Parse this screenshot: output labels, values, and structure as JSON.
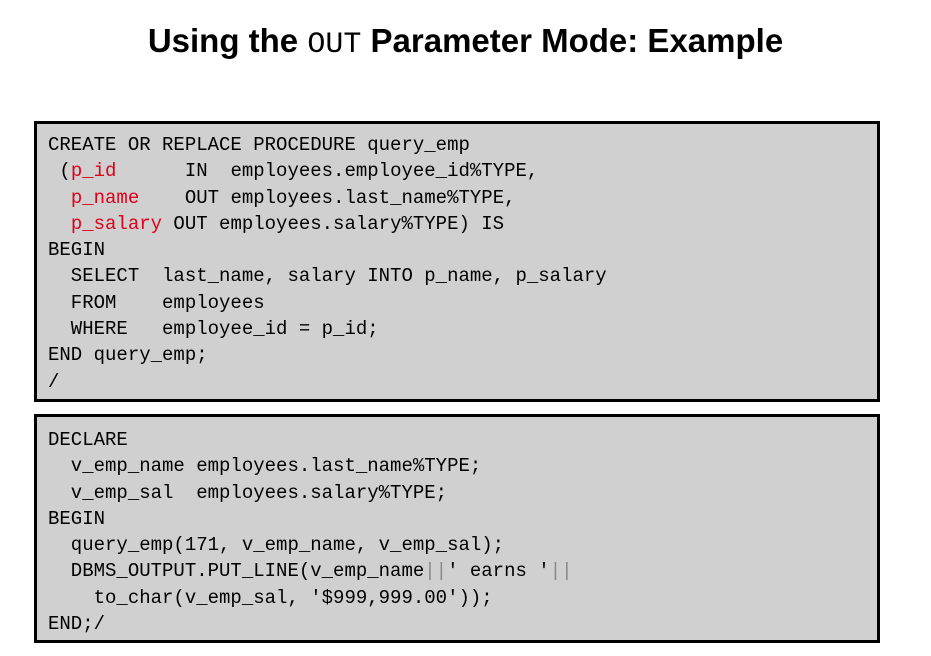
{
  "title": {
    "before": "Using the ",
    "code": "OUT",
    "after": " Parameter Mode: Example"
  },
  "procedure_code": {
    "lines": [
      [
        {
          "text": "CREATE OR REPLACE PROCEDURE query_emp",
          "style": "normal"
        }
      ],
      [
        {
          "text": " (",
          "style": "normal"
        },
        {
          "text": "p_id",
          "style": "red"
        },
        {
          "text": "      IN  employees.employee_id%TYPE,",
          "style": "normal"
        }
      ],
      [
        {
          "text": "  ",
          "style": "normal"
        },
        {
          "text": "p_name",
          "style": "red"
        },
        {
          "text": "    OUT employees.last_name%TYPE,",
          "style": "normal"
        }
      ],
      [
        {
          "text": "  ",
          "style": "normal"
        },
        {
          "text": "p_salary",
          "style": "red"
        },
        {
          "text": " OUT employees.salary%TYPE) IS",
          "style": "normal"
        }
      ],
      [
        {
          "text": "BEGIN",
          "style": "normal"
        }
      ],
      [
        {
          "text": "  SELECT  last_name, salary INTO p_name, p_salary",
          "style": "normal"
        }
      ],
      [
        {
          "text": "  FROM    employees",
          "style": "normal"
        }
      ],
      [
        {
          "text": "  WHERE   employee_id = p_id;",
          "style": "normal"
        }
      ],
      [
        {
          "text": "END query_emp;",
          "style": "normal"
        }
      ],
      [
        {
          "text": "/",
          "style": "normal"
        }
      ]
    ]
  },
  "call_code": {
    "lines": [
      [
        {
          "text": "DECLARE",
          "style": "normal"
        }
      ],
      [
        {
          "text": "  v_emp_name employees.last_name%TYPE;",
          "style": "normal"
        }
      ],
      [
        {
          "text": "  v_emp_sal  employees.salary%TYPE;",
          "style": "normal"
        }
      ],
      [
        {
          "text": "BEGIN",
          "style": "normal"
        }
      ],
      [
        {
          "text": "  query_emp(171, v_emp_name, v_emp_sal);",
          "style": "normal"
        }
      ],
      [
        {
          "text": "  DBMS_OUTPUT.PUT_LINE(v_emp_name",
          "style": "normal"
        },
        {
          "text": "||",
          "style": "grey"
        },
        {
          "text": "' earns '",
          "style": "normal"
        },
        {
          "text": "||",
          "style": "grey"
        }
      ],
      [
        {
          "text": "    to_char(v_emp_sal, '$999,999.00'));",
          "style": "normal"
        }
      ],
      [
        {
          "text": "END;/",
          "style": "normal"
        }
      ]
    ]
  }
}
